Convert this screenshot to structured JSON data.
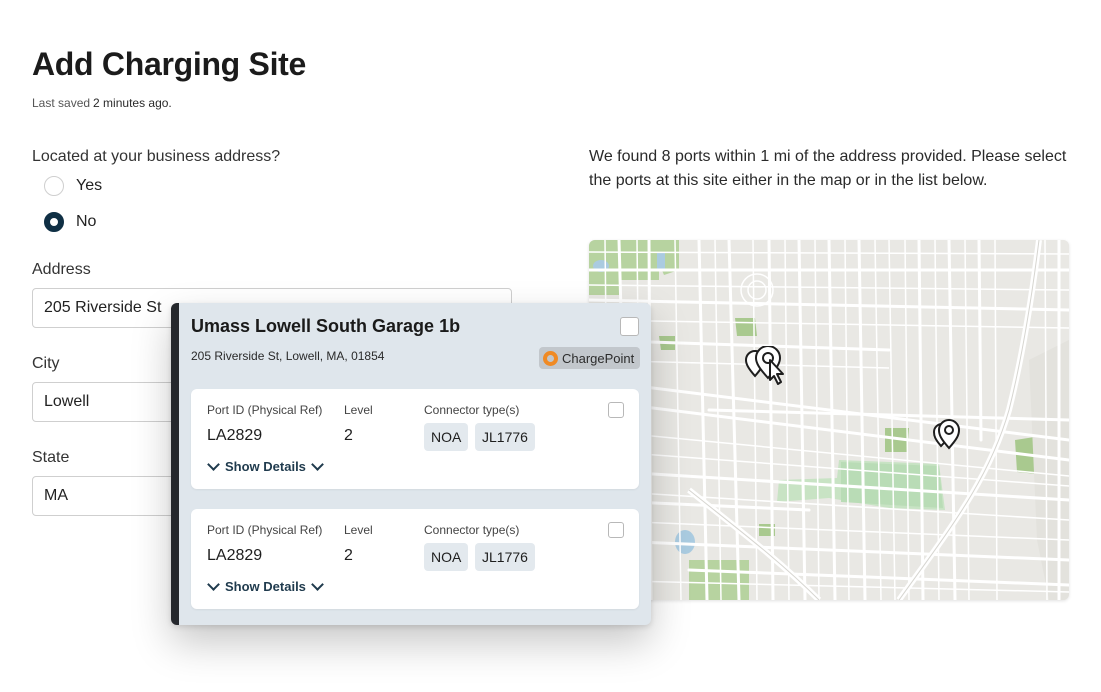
{
  "page": {
    "title": "Add Charging Site",
    "last_saved_label": "Last saved",
    "last_saved_value": "2 minutes ago."
  },
  "form": {
    "business_question": "Located at your business address?",
    "options": [
      {
        "label": "Yes",
        "selected": false
      },
      {
        "label": "No",
        "selected": true
      }
    ],
    "address_label": "Address",
    "address_value": "205 Riverside St",
    "city_label": "City",
    "city_value": "Lowell",
    "state_label": "State",
    "state_value": "MA"
  },
  "results": {
    "message": "We found 8 ports within 1 mi of the address provided. Please select the ports at this site either in the map or in the list below."
  },
  "site_card": {
    "name": "Umass Lowell South Garage 1b",
    "address": "205 Riverside St, Lowell, MA, 01854",
    "network": "ChargePoint",
    "ports": [
      {
        "port_id_label": "Port ID (Physical Ref)",
        "port_id": "LA2829",
        "level_label": "Level",
        "level": "2",
        "connector_label": "Connector type(s)",
        "connectors": [
          "NOA",
          "JL1776"
        ],
        "details_label": "Show Details"
      },
      {
        "port_id_label": "Port ID (Physical Ref)",
        "port_id": "LA2829",
        "level_label": "Level",
        "level": "2",
        "connector_label": "Connector type(s)",
        "connectors": [
          "NOA",
          "JL1776"
        ],
        "details_label": "Show Details"
      }
    ]
  },
  "colors": {
    "primary": "#0f2f44",
    "card_bg": "#dfe6ec",
    "card_accent": "#25282d",
    "map_bg": "#e9e8e4",
    "park_green": "#a9c98f",
    "chargepoint_orange": "#f08a24"
  },
  "icons": [
    "map-pin-icon",
    "cursor-icon",
    "chevron-down-icon",
    "chargepoint-logo-icon"
  ]
}
